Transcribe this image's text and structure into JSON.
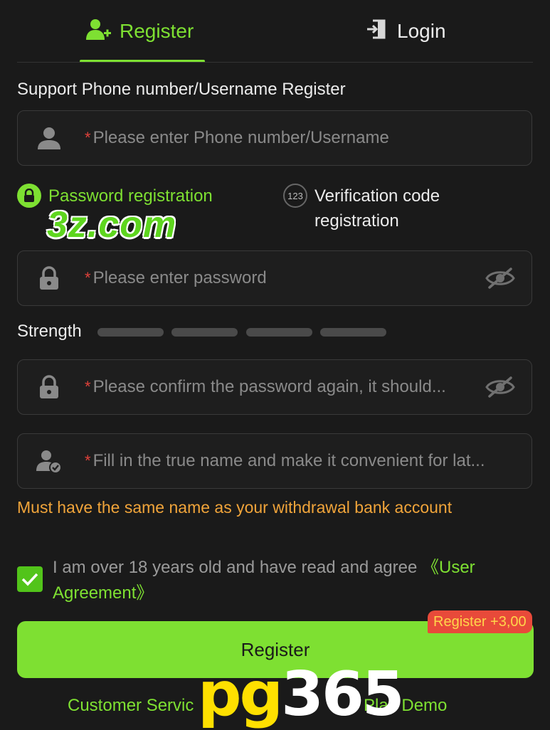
{
  "tabs": {
    "register": "Register",
    "login": "Login"
  },
  "form": {
    "section_title": "Support Phone number/Username Register",
    "username": {
      "value": "",
      "placeholder": "Please enter Phone number/Username",
      "required_mark": "*"
    },
    "mode_options": {
      "password": "Password registration",
      "verification": "Verification code registration",
      "verification_icon_text": "123"
    },
    "password": {
      "value": "",
      "placeholder": "Please enter password",
      "required_mark": "*"
    },
    "strength": {
      "label": "Strength",
      "level": 0,
      "segments": 4
    },
    "confirm": {
      "value": "",
      "placeholder": "Please confirm the password again, it should...",
      "required_mark": "*"
    },
    "realname": {
      "value": "",
      "placeholder": "Fill in the true name and make it convenient for lat...",
      "required_mark": "*"
    },
    "warning": "Must have the same name as your withdrawal bank account",
    "agreement": {
      "checked": true,
      "text": "I am over 18 years old and have read and agree ",
      "link": "《User Agreement》"
    },
    "submit_label": "Register",
    "bonus_badge": "Register +3,00"
  },
  "footer": {
    "customer_service": "Customer Servic",
    "play_demo": "Play Demo"
  },
  "overlays": {
    "watermark": "3z.com",
    "brand_a": "pg",
    "brand_b": "365"
  },
  "colors": {
    "accent": "#7ee032",
    "warning": "#f0a43a",
    "required": "#e0413a",
    "badge": "#e84a3a"
  }
}
